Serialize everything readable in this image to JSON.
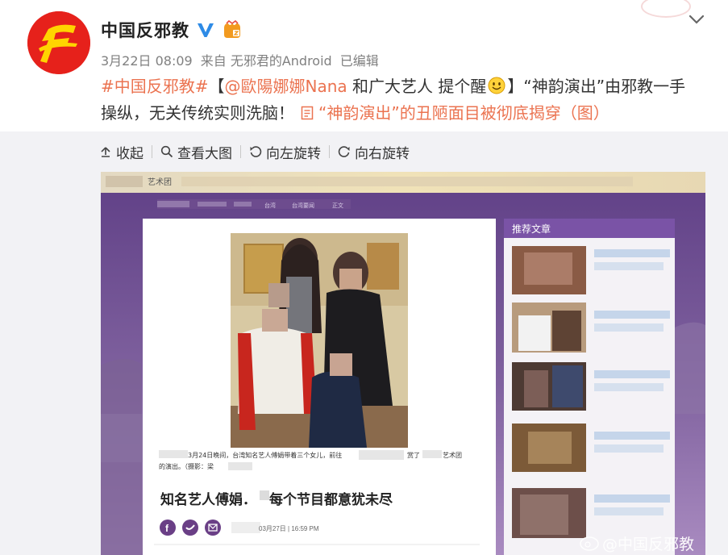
{
  "profile": {
    "name": "中国反邪教",
    "verified_icon": "verified-v-icon",
    "medal_icon": "fan-medal-icon"
  },
  "meta": {
    "time": "3月22日 08:09",
    "source": "来自 无邪君的Android",
    "edited": "已编辑"
  },
  "post": {
    "hashtag": "#中国反邪教#",
    "bracket_open": "【",
    "mention": "@歐陽娜娜Nana",
    "text1": " 和广大艺人 提个醒",
    "text2": "】“神韵演出”由邪教一手操纵，无关传统实则洗脑！",
    "link_text": "“神韵演出”的丑陋面目被彻底揭穿（图）"
  },
  "toolbar": {
    "collapse": "收起",
    "view_large": "查看大图",
    "rotate_left": "向左旋转",
    "rotate_right": "向右旋转"
  },
  "screenshot": {
    "top_bar_label": "艺术团",
    "breadcrumb": [
      "台湾",
      "台湾要闻",
      "正文"
    ],
    "sidebar_title": "推荐文章",
    "caption_line1": "3月24日晚间，台湾知名艺人傅娟带着三个女儿，前往",
    "caption_tail1": "赏了",
    "caption_tail2": "艺术团",
    "caption_line2": "的演出。（摄影：梁",
    "headline_a": "知名艺人傅娟．",
    "headline_b": "每个节目都意犹未尽",
    "date": "03月27日 | 16:59 PM",
    "watermark": "@中国反邪教"
  },
  "colors": {
    "link": "#eb7350",
    "page_purple": "#6d4c8e",
    "sidebar_purple": "#7a53a6",
    "avatar_red": "#e6211b",
    "verified_blue": "#2e8be6"
  }
}
